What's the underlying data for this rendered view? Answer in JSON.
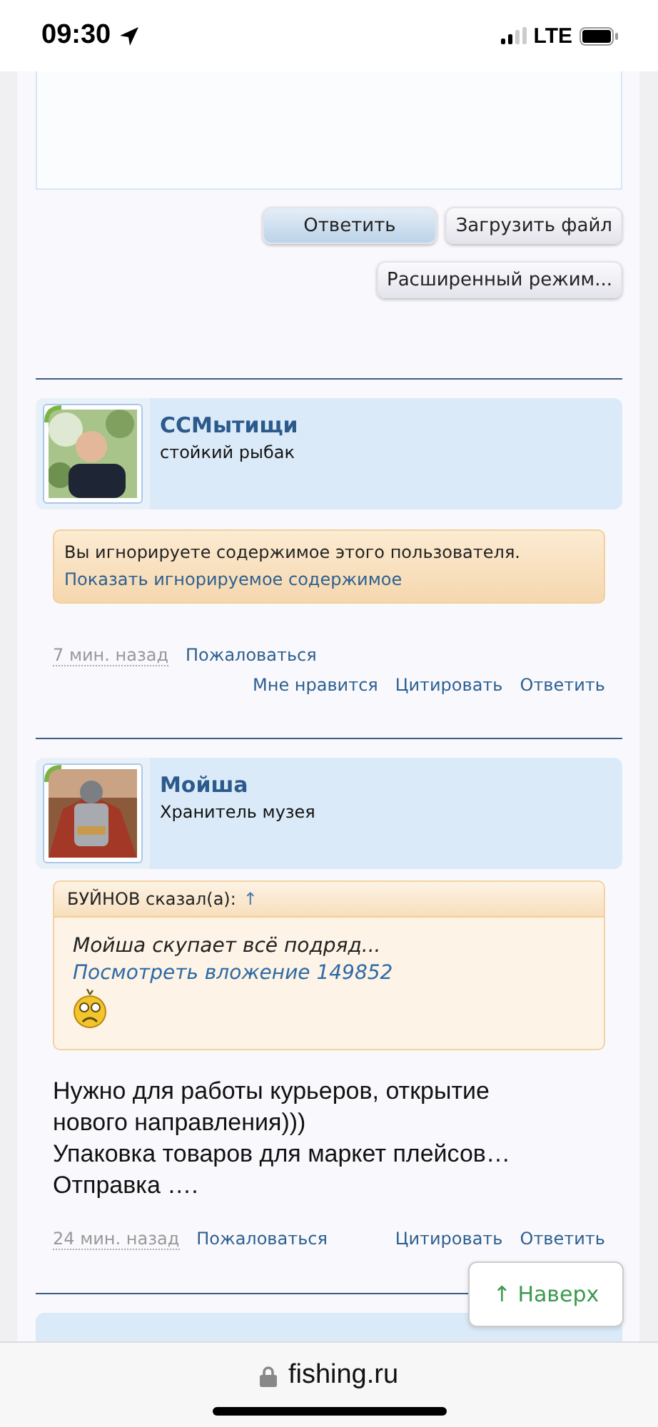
{
  "status_bar": {
    "time": "09:30",
    "network": "LTE"
  },
  "reply_form": {
    "buttons": [
      {
        "label": "Ответить",
        "kind": "primary"
      },
      {
        "label": "Загрузить файл",
        "kind": "secondary"
      },
      {
        "label": "Расширенный режим...",
        "kind": "secondary"
      }
    ]
  },
  "posts": [
    {
      "author": "ССМытищи",
      "user_title": "стойкий рыбак",
      "avatar": {
        "kind": "picture"
      },
      "ignored_notice": {
        "text": "Вы игнорируете содержимое этого пользователя.",
        "link": "Показать игнорируемое содержимое"
      },
      "time": "7 мин. назад",
      "report": "Пожаловаться",
      "actions": [
        "Мне нравится",
        "Цитировать",
        "Ответить"
      ]
    },
    {
      "author": "Мойша",
      "user_title": "Хранитель музея",
      "avatar": {
        "kind": "picture"
      },
      "quote": {
        "header": "БУЙНОВ сказал(а):",
        "arrow": "↑",
        "text": "Мойша скупает всё подряд...",
        "link": "Посмотреть вложение 149852"
      },
      "body": [
        "Нужно для работы курьеров, открытие нового направления)))",
        "Упаковка товаров для маркет плейсов…",
        "Отправка …."
      ],
      "time": "24 мин. назад",
      "report": "Пожаловаться",
      "actions": [
        "Цитировать",
        "Ответить"
      ]
    }
  ],
  "back_to_top": "↑ Наверх",
  "url_bar": {
    "domain": "fishing.ru"
  }
}
